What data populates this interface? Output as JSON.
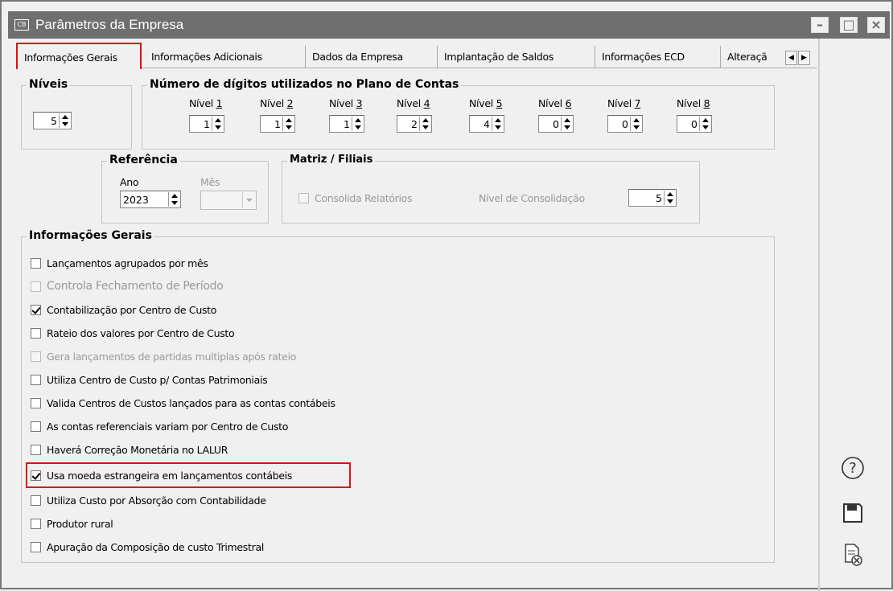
{
  "window": {
    "title": "Parâmetros da Empresa",
    "app_icon_text": "CB",
    "controls": {
      "minimize": "–",
      "maximize": "□",
      "close": "×"
    }
  },
  "tabs": [
    {
      "label": "Informações Gerais",
      "active": true
    },
    {
      "label": "Informações Adicionais"
    },
    {
      "label": "Dados da Empresa"
    },
    {
      "label": "Implantação de Saldos"
    },
    {
      "label": "Informações ECD"
    },
    {
      "label": "Alteraçã"
    }
  ],
  "tab_scroll": {
    "left": "◀",
    "right": "▶"
  },
  "niveis": {
    "legend": "Níveis",
    "value": "5"
  },
  "digitos": {
    "legend": "Número de dígitos utilizados no Plano de Contas",
    "levels": [
      {
        "prefix": "Nível ",
        "num": "1",
        "value": "1"
      },
      {
        "prefix": "Nível ",
        "num": "2",
        "value": "1"
      },
      {
        "prefix": "Nível ",
        "num": "3",
        "value": "1"
      },
      {
        "prefix": "Nível ",
        "num": "4",
        "value": "2"
      },
      {
        "prefix": "Nível ",
        "num": "5",
        "value": "4"
      },
      {
        "prefix": "Nível ",
        "num": "6",
        "value": "0"
      },
      {
        "prefix": "Nível ",
        "num": "7",
        "value": "0"
      },
      {
        "prefix": "Nível ",
        "num": "8",
        "value": "0"
      }
    ]
  },
  "referencia": {
    "legend": "Referência",
    "ano_label": "Ano",
    "ano_value": "2023",
    "mes_label": "Mês",
    "mes_value": ""
  },
  "matriz": {
    "legend": "Matriz / Filiais",
    "consolida_label": "Consolida Relatórios",
    "nivel_label": "Nível de Consolidação",
    "nivel_value": "5"
  },
  "info_gerais": {
    "legend": "Informações Gerais",
    "options": [
      {
        "label": "Lançamentos agrupados por mês",
        "checked": false,
        "disabled": false
      },
      {
        "label": "Controla Fechamento de Período",
        "checked": false,
        "disabled": true
      },
      {
        "label": "Contabilização por Centro de Custo",
        "checked": true,
        "disabled": false
      },
      {
        "label": "Rateio dos valores por Centro de Custo",
        "checked": false,
        "disabled": false
      },
      {
        "label": "Gera lançamentos de partidas multiplas após rateio",
        "checked": false,
        "disabled": true
      },
      {
        "label": "Utiliza Centro de  Custo p/ Contas Patrimoniais",
        "checked": false,
        "disabled": false
      },
      {
        "label": "Valida Centros de Custos lançados para as contas contábeis",
        "checked": false,
        "disabled": false
      },
      {
        "label": "As contas referenciais variam por Centro de Custo",
        "checked": false,
        "disabled": false
      },
      {
        "label": "Haverá Correção Monetária  no LALUR",
        "checked": false,
        "disabled": false
      },
      {
        "label": "Usa moeda estrangeira em lançamentos contábeis",
        "checked": true,
        "disabled": false,
        "highlighted": true
      },
      {
        "label": "Utiliza Custo por Absorção com Contabilidade",
        "checked": false,
        "disabled": false
      },
      {
        "label": "Produtor rural",
        "checked": false,
        "disabled": false
      },
      {
        "label": "Apuração da Composição de custo Trimestral",
        "checked": false,
        "disabled": false
      }
    ]
  },
  "side_buttons": [
    {
      "name": "help-button",
      "icon": "help-icon"
    },
    {
      "name": "save-button",
      "icon": "save-icon"
    },
    {
      "name": "cancel-button",
      "icon": "cancel-document-icon"
    }
  ],
  "colors": {
    "highlight": "#e01010",
    "titlebar": "#6f6f6f"
  }
}
